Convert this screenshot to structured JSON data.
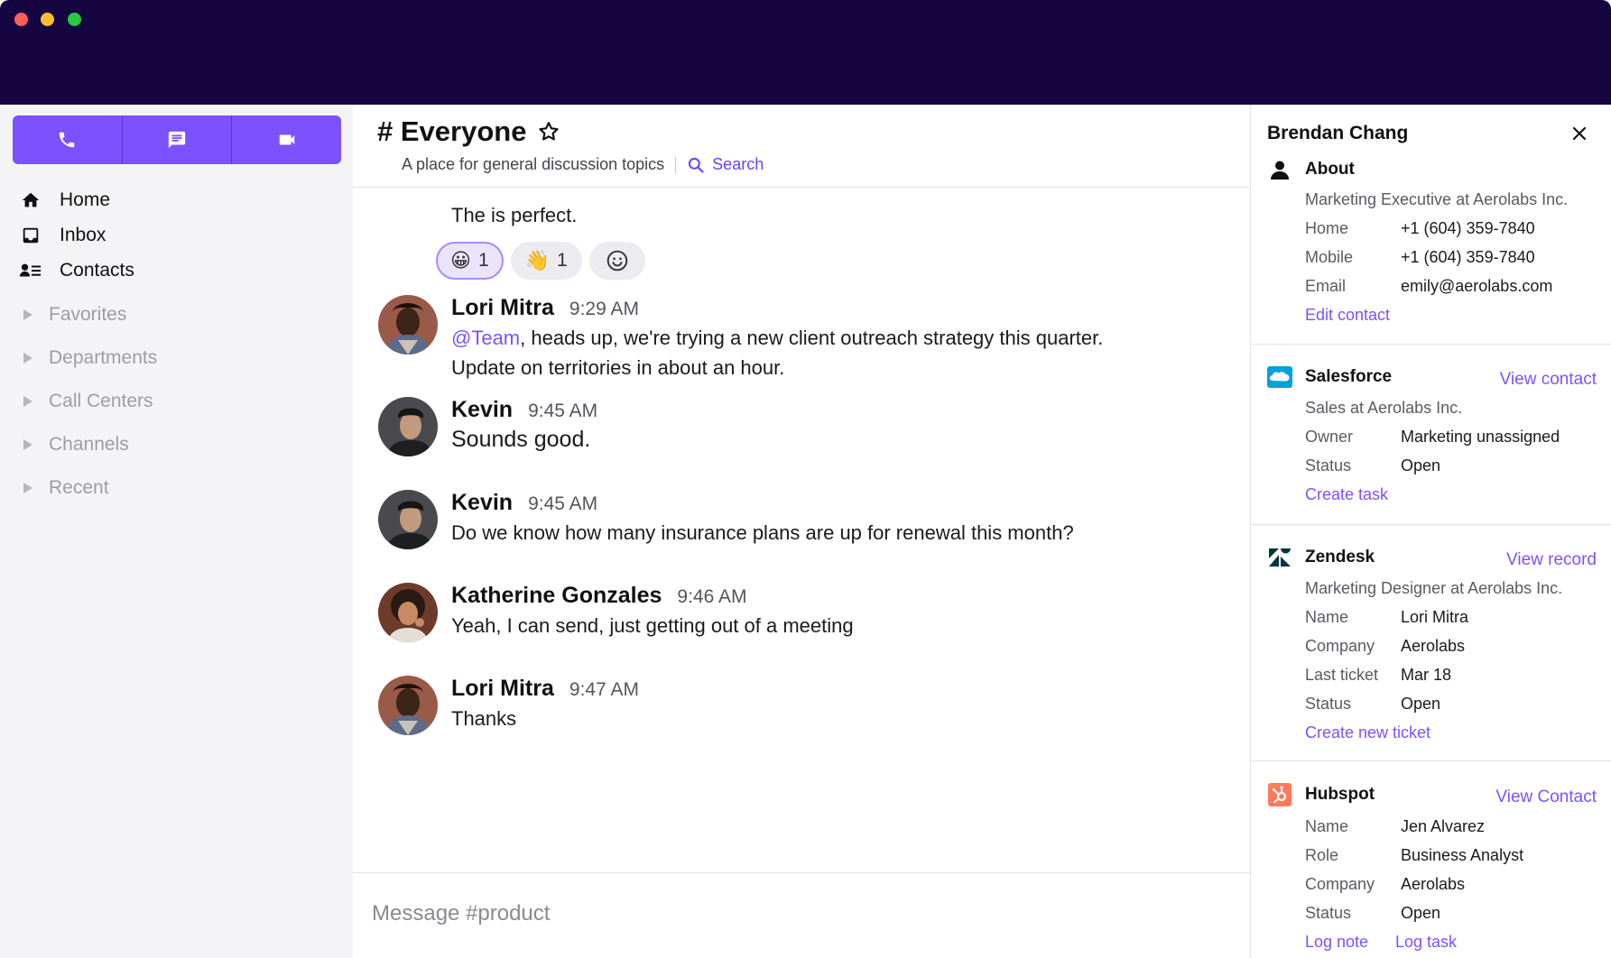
{
  "window": {
    "controls": [
      "close",
      "minimize",
      "zoom"
    ]
  },
  "sidebar": {
    "call_actions": [
      {
        "icon": "phone-icon"
      },
      {
        "icon": "message-icon"
      },
      {
        "icon": "video-icon"
      }
    ],
    "nav": [
      {
        "label": "Home",
        "icon": "home-icon"
      },
      {
        "label": "Inbox",
        "icon": "inbox-icon"
      },
      {
        "label": "Contacts",
        "icon": "contacts-icon"
      }
    ],
    "sections": [
      "Favorites",
      "Departments",
      "Call Centers",
      "Channels",
      "Recent"
    ]
  },
  "channel": {
    "title": "# Everyone",
    "description": "A place for general discussion topics",
    "search_label": "Search"
  },
  "first_message_tail": {
    "text": "The is perfect.",
    "reactions": [
      {
        "emoji": "😀",
        "count": "1",
        "active": true
      },
      {
        "emoji": "👋",
        "count": "1",
        "active": false
      }
    ]
  },
  "messages": [
    {
      "name": "Lori Mitra",
      "time": "9:29 AM",
      "mention": "@Team",
      "text": ", heads up, we're trying a new client outreach strategy this quarter.",
      "text2": "Update on territories in about an hour."
    },
    {
      "name": "Kevin",
      "time": "9:45 AM",
      "text": "Sounds good."
    },
    {
      "name": "Kevin",
      "time": "9:45 AM",
      "text": "Do we know how many insurance plans are up for renewal this month?"
    },
    {
      "name": "Katherine Gonzales",
      "time": "9:46 AM",
      "text": "Yeah, I can send, just getting out of a meeting"
    },
    {
      "name": "Lori Mitra",
      "time": "9:47 AM",
      "text": "Thanks"
    }
  ],
  "composer": {
    "placeholder": "Message #product"
  },
  "panel": {
    "title": "Brendan Chang",
    "about": {
      "heading": "About",
      "subtitle": "Marketing Executive at Aerolabs Inc.",
      "fields": [
        {
          "k": "Home",
          "v": "+1 (604) 359-7840"
        },
        {
          "k": "Mobile",
          "v": "+1 (604) 359-7840"
        },
        {
          "k": "Email",
          "v": "emily@aerolabs.com"
        }
      ],
      "action": "Edit contact"
    },
    "salesforce": {
      "heading": "Salesforce",
      "link": "View contact",
      "subtitle": "Sales at Aerolabs Inc.",
      "fields": [
        {
          "k": "Owner",
          "v": "Marketing unassigned"
        },
        {
          "k": "Status",
          "v": "Open"
        }
      ],
      "action": "Create task"
    },
    "zendesk": {
      "heading": "Zendesk",
      "link": "View record",
      "subtitle": "Marketing Designer at Aerolabs Inc.",
      "fields": [
        {
          "k": "Name",
          "v": "Lori Mitra"
        },
        {
          "k": "Company",
          "v": "Aerolabs"
        },
        {
          "k": "Last ticket",
          "v": "Mar 18"
        },
        {
          "k": "Status",
          "v": "Open"
        }
      ],
      "action": "Create new ticket"
    },
    "hubspot": {
      "heading": "Hubspot",
      "link": "View Contact",
      "fields": [
        {
          "k": "Name",
          "v": "Jen Alvarez"
        },
        {
          "k": "Role",
          "v": "Business Analyst"
        },
        {
          "k": "Company",
          "v": "Aerolabs"
        },
        {
          "k": "Status",
          "v": "Open"
        }
      ],
      "actions": [
        "Log note",
        "Log task"
      ]
    }
  },
  "colors": {
    "titlebar": "#150642",
    "accent": "#7c52ff",
    "sidebar_bg": "#f4f4f6",
    "salesforce": "#00a1e0",
    "hubspot": "#ff7a59"
  }
}
